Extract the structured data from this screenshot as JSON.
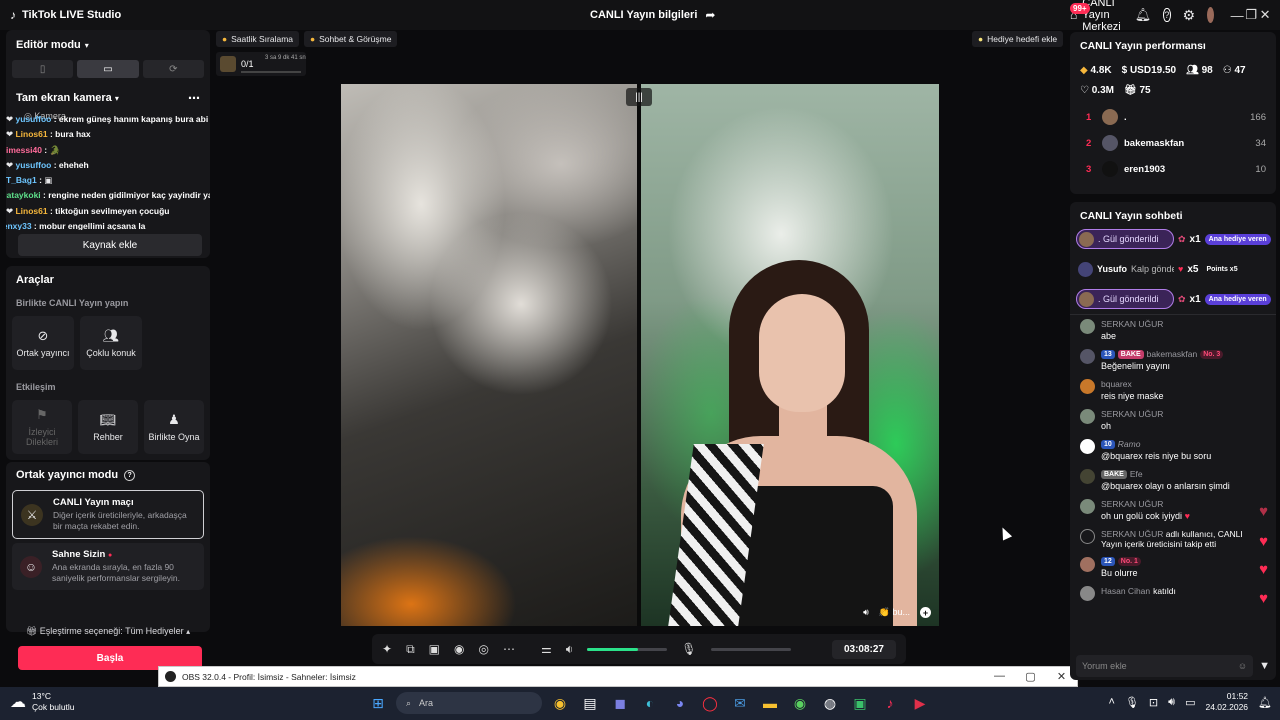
{
  "titlebar": {
    "app_name": "TikTok LIVE Studio",
    "center_title": "CANLI Yayın bilgileri",
    "center_button": "CANLI Yayın Merkezi",
    "notification_badge": "99+"
  },
  "left": {
    "editor_mode": "Editör modu",
    "camera_title": "Tam ekran kamera",
    "camera_source": "Kamera",
    "mini_chat": [
      {
        "user": "yusuffoo",
        "msg": " : ekrem güneş hanım kapanış bura abi"
      },
      {
        "user": "Linos61",
        "msg": " : bura hax"
      },
      {
        "user": "imessi40",
        "msg": " : "
      },
      {
        "user": "yusuffoo",
        "msg": " : eheheh"
      },
      {
        "user": "T_Bag1",
        "msg": " : "
      },
      {
        "user": "cagataykoki",
        "msg": " : rengine neden gidilmiyor kaç yayindir ya"
      },
      {
        "user": "Linos61",
        "msg": " : tiktoğun sevilmeyen çocuğu"
      },
      {
        "user": "venxy33",
        "msg": " : mobur engellimi açsana la"
      }
    ],
    "add_source": "Kaynak ekle",
    "tools_title": "Araçlar",
    "together_title": "Birlikte CANLI Yayın yapın",
    "tool_cohost": "Ortak yayıncı",
    "tool_multi": "Çoklu konuk",
    "interaction_title": "Etkileşim",
    "tool_wishes": "İzleyici Dilekleri",
    "tool_guide": "Rehber",
    "tool_play": "Birlikte Oyna",
    "cohost_mode_title": "Ortak yayıncı modu",
    "mode1_title": "CANLI Yayın maçı",
    "mode1_desc": "Diğer içerik üreticileriyle, arkadaşça bir maçta rekabet edin.",
    "mode2_title": "Sahne Sizin",
    "mode2_desc": "Ana ekranda sırayla, en fazla 90 saniyelik performanslar sergileyin.",
    "pair_option": "Eşleştirme seçeneği: Tüm Hediyeler",
    "start": "Başla"
  },
  "center": {
    "chip_hourly": "Saatlik Sıralama",
    "chip_chat": "Sohbet & Görüşme",
    "chip_gift_goal": "Hediye hedefi ekle",
    "goal_count": "0/1",
    "goal_time": "3 sa 9 dk 41 sn",
    "overlay_text": "bu...",
    "timer": "03:08:27",
    "volume_fraction": 0.64
  },
  "obs": {
    "title": "OBS 32.0.4 - Profil: İsimsiz - Sahneler: İsimsiz"
  },
  "right": {
    "perf_title": "CANLI Yayın performansı",
    "stat_diamonds": "4.8K",
    "stat_usd": "USD19.50",
    "stat_viewers": "98",
    "stat_new": "47",
    "stat_likes": "0.3M",
    "stat_gifts": "75",
    "ranking": [
      {
        "rank": "1",
        "name": ".",
        "score": "166"
      },
      {
        "rank": "2",
        "name": "bakemaskfan",
        "score": "34"
      },
      {
        "rank": "3",
        "name": "eren1903",
        "score": "10"
      }
    ],
    "chat_title": "CANLI Yayın sohbeti",
    "gifts": [
      {
        "text": ". Gül gönderildi",
        "count": "x1",
        "tag": "Ana hediye veren"
      },
      {
        "user": "Yusufo",
        "text": "Kalp gönderdi",
        "count": "x5",
        "tag": "Points x5"
      },
      {
        "text": ". Gül gönderildi",
        "count": "x1",
        "tag": "Ana hediye veren"
      }
    ],
    "messages": [
      {
        "user": "SERKAN UĞUR",
        "text": "abe"
      },
      {
        "level": "13",
        "fan": "BAKE",
        "user": "bakemaskfan",
        "no": "No. 3",
        "text": "Beğenelim yayını"
      },
      {
        "user": "bquarex",
        "text": "reis niye maske"
      },
      {
        "user": "SERKAN UĞUR",
        "text": "oh"
      },
      {
        "level": "10",
        "user": "Ramo",
        "text": "@bquarex reis niye bu soru"
      },
      {
        "fan": "BAKE",
        "user": "Efe",
        "text": "@bquarex olayı o anlarsın şimdi"
      },
      {
        "user": "SERKAN UĞUR",
        "text": "oh un golü cok iyiydi"
      },
      {
        "user": "SERKAN UĞUR",
        "text": "adlı kullanıcı, CANLI Yayın içerik üreticisini takip etti"
      },
      {
        "level": "12",
        "no": "No. 1",
        "text": "Bu olurre"
      },
      {
        "user": "Hasan Cihan",
        "text": "katıldı"
      }
    ],
    "comment_placeholder": "Yorum ekle"
  },
  "taskbar": {
    "temp": "13°C",
    "weather": "Çok bulutlu",
    "search": "Ara",
    "time": "01:52",
    "date": "24.02.2026"
  },
  "colors": {
    "accent": "#fe2c55",
    "volume": "#2be28a",
    "gift_border": "#b07de8"
  }
}
